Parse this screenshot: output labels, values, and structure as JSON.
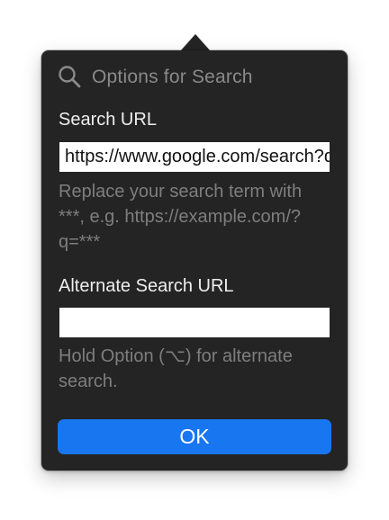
{
  "popover": {
    "title": "Options for Search",
    "title_icon": "search-icon",
    "search_url": {
      "label": "Search URL",
      "value": "https://www.google.com/search?q=***",
      "placeholder": "",
      "help": "Replace your search term with ***, e.g. https://example.com/?q=***"
    },
    "alternate_search_url": {
      "label": "Alternate Search URL",
      "value": "",
      "placeholder": "",
      "help": "Hold Option (⌥) for alternate search."
    },
    "ok_label": "OK"
  },
  "colors": {
    "panel_background": "#242424",
    "title_text": "#8a8a8a",
    "label_text": "#eeeeee",
    "help_text": "#7e7e7e",
    "field_background": "#ffffff",
    "accent": "#1876f0"
  }
}
